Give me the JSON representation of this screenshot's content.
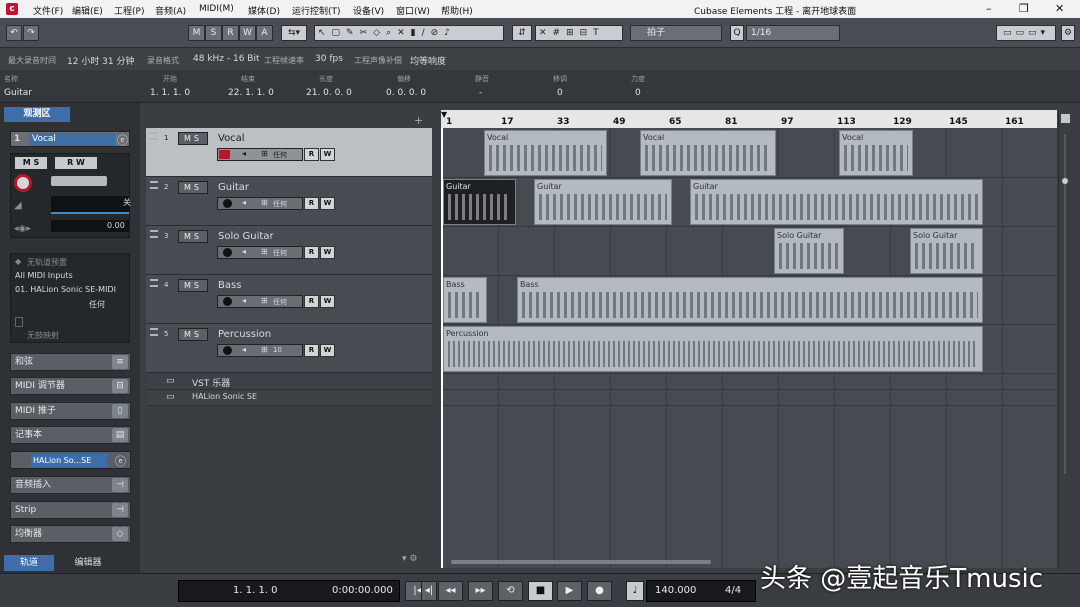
{
  "menubar": {
    "items": [
      "文件(F)",
      "编辑(E)",
      "工程(P)",
      "音频(A)",
      "MIDI(M)",
      "媒体(D)",
      "运行控制(T)",
      "设备(V)",
      "窗口(W)",
      "帮助(H)"
    ],
    "window_title": "Cubase Elements 工程 - 离开地球表面",
    "win_min": "–",
    "win_max": "❐",
    "win_close": "✕"
  },
  "toolbar": {
    "undo": "↶",
    "redo": "↷",
    "mswa": [
      "M",
      "S",
      "R",
      "W",
      "A"
    ],
    "snap_type": "拍子",
    "quantize": "1/16"
  },
  "infobar": {
    "max_rec_label": "最大录音时间",
    "max_rec_value": "12 小时 31 分钟",
    "rec_format_label": "录音格式",
    "rec_format_value": "48 kHz - 16 Bit",
    "frame_rate_label": "工程帧速率",
    "frame_rate_value": "30 fps",
    "pan_law_label": "工程声像补偿",
    "pan_law_value": "均等响度"
  },
  "eventline": {
    "name_h": "名称",
    "name_v": "Guitar",
    "start_h": "开始",
    "start_v": "1. 1. 1. 0",
    "end_h": "结束",
    "end_v": "22. 1. 1. 0",
    "len_h": "长度",
    "len_v": "21. 0. 0. 0",
    "off_h": "偏移",
    "off_v": "0. 0. 0. 0",
    "mute_h": "静音",
    "mute_v": "-",
    "trans_h": "移调",
    "trans_v": "0",
    "vel_h": "力度",
    "vel_v": "0"
  },
  "inspector": {
    "tab": "观测区",
    "track_num": "1",
    "track_name": "Vocal",
    "ms": "M S",
    "rw": "R W",
    "pan_label": "关",
    "vol_value": "0.00",
    "no_preset": "无轨道预置",
    "midi_in": "All MIDI Inputs",
    "midi_out": "01. HALion Sonic SE-MIDI",
    "channel": "任何",
    "no_map": "无鼓映射",
    "sections": [
      "和弦",
      "MIDI 调节器",
      "MIDI 推子",
      "记事本"
    ],
    "instrument": "HALion So...SE",
    "sections2": [
      "音频插入",
      "Strip",
      "均衡器"
    ],
    "bottom_tab1": "轨道",
    "bottom_tab2": "编辑器"
  },
  "tracks": [
    {
      "num": "1",
      "name": "Vocal",
      "chan": "任何"
    },
    {
      "num": "2",
      "name": "Guitar",
      "chan": "任何"
    },
    {
      "num": "3",
      "name": "Solo Guitar",
      "chan": "任何"
    },
    {
      "num": "4",
      "name": "Bass",
      "chan": "任何"
    },
    {
      "num": "5",
      "name": "Percussion",
      "chan": "10"
    }
  ],
  "folders": [
    "VST 乐器",
    "HALion Sonic SE"
  ],
  "ruler": [
    "1",
    "17",
    "33",
    "49",
    "65",
    "81",
    "97",
    "113",
    "129",
    "145",
    "161"
  ],
  "parts": [
    {
      "label": "Vocal"
    },
    {
      "label": "Vocal"
    },
    {
      "label": "Vocal"
    },
    {
      "label": "Guitar"
    },
    {
      "label": "Guitar"
    },
    {
      "label": "Guitar"
    },
    {
      "label": "Solo Guitar"
    },
    {
      "label": "Solo Guitar"
    },
    {
      "label": "Bass"
    },
    {
      "label": "Bass"
    },
    {
      "label": "Percussion"
    }
  ],
  "transport": {
    "pos_bars": "1. 1. 1.  0",
    "pos_time": "0:00:00.000",
    "tempo": "140.000",
    "sig": "4/4"
  },
  "watermark": "头条 @壹起音乐Tmusic",
  "colors": {
    "accent": "#3e6ea8",
    "record": "#b7182a",
    "part": "#b4bac1"
  }
}
